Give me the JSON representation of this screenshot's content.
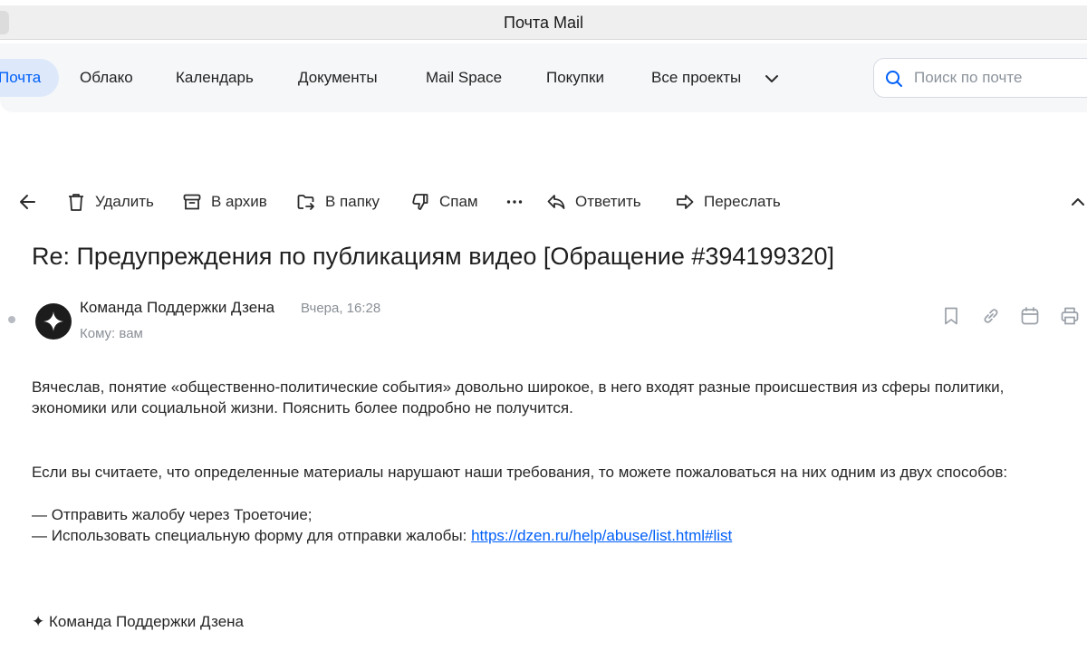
{
  "window": {
    "title": "Почта Mail"
  },
  "nav": {
    "items": [
      {
        "label": "Почта",
        "active": true
      },
      {
        "label": "Облако"
      },
      {
        "label": "Календарь"
      },
      {
        "label": "Документы"
      },
      {
        "label": "Mail Space"
      },
      {
        "label": "Покупки"
      },
      {
        "label": "Все проекты"
      }
    ],
    "search_placeholder": "Поиск по почте"
  },
  "toolbar": {
    "delete_label": "Удалить",
    "archive_label": "В архив",
    "folder_label": "В папку",
    "spam_label": "Спам",
    "reply_label": "Ответить",
    "forward_label": "Переслать"
  },
  "message": {
    "subject": "Re: Предупреждения по публикациям видео [Обращение #394199320]",
    "sender": "Команда Поддержки Дзена",
    "date": "Вчера, 16:28",
    "recipient": "Кому: вам",
    "body": {
      "para1_line1": "Вячеслав, понятие «общественно-политические события» довольно широкое, в него входят разные происшествия из сферы политики,",
      "para1_line2": "экономики или социальной жизни. Пояснить более подробно не получится.",
      "para2": "Если вы считаете, что определенные материалы нарушают наши требования, то можете пожаловаться на них одним из двух способов:",
      "item1": "— Отправить жалобу через Троеточие;",
      "item2_prefix": "— Использовать специальную форму для отправки жалобы: ",
      "item2_link": "https://dzen.ru/help/abuse/list.html#list",
      "signature": "✦ Команда Поддержки Дзена"
    }
  },
  "colors": {
    "accent": "#005ff9",
    "active_nav_bg": "#dde9fb",
    "nav_bg": "#f6f7f9"
  }
}
